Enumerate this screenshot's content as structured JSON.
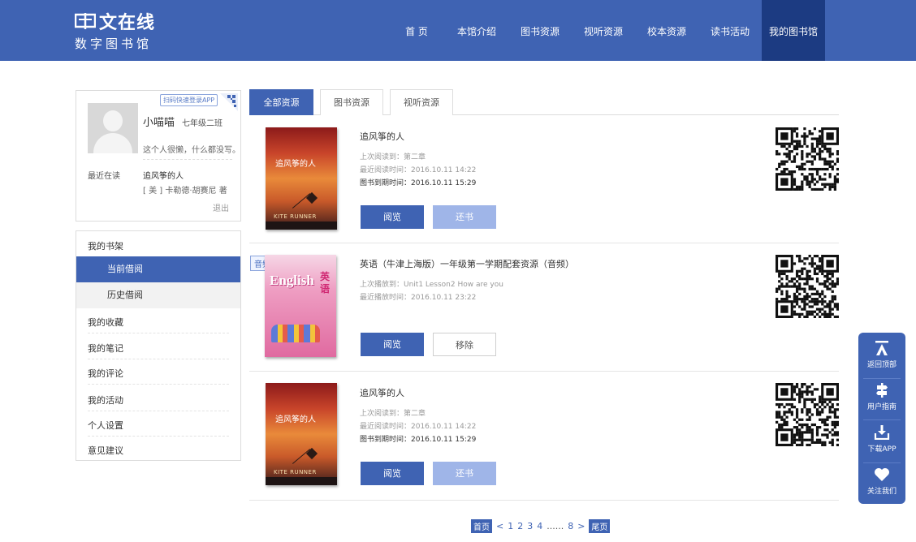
{
  "header": {
    "logo_title": "文在线",
    "logo_sub": "数字图书馆",
    "nav": [
      {
        "label": "首 页"
      },
      {
        "label": "本馆介绍"
      },
      {
        "label": "图书资源"
      },
      {
        "label": "视听资源"
      },
      {
        "label": "校本资源"
      },
      {
        "label": "读书活动"
      },
      {
        "label": "我的图书馆",
        "active": true
      }
    ]
  },
  "profile": {
    "scan_tag": "扫码快速登录APP",
    "username": "小喵喵",
    "grade": "七年级二班",
    "motto": "这个人很懒，什么都没写。",
    "recent_label": "最近在读",
    "recent_book": "追风筝的人",
    "recent_author": "[ 美 ] 卡勒德·胡赛尼  著",
    "logout": "退出"
  },
  "menu": {
    "shelf": "我的书架",
    "current": "当前借阅",
    "history": "历史借阅",
    "favorites": "我的收藏",
    "notes": "我的笔记",
    "comments": "我的评论",
    "activities": "我的活动",
    "settings": "个人设置",
    "feedback": "意见建议"
  },
  "tabs": [
    "全部资源",
    "图书资源",
    "视听资源"
  ],
  "items": [
    {
      "cover_title": "追风筝的人",
      "cover_sub": "KITE RUNNER",
      "title": "追风筝的人",
      "meta1": "上次阅读到：第二章",
      "meta2": "最近阅读时间：2016.10.11 14:22",
      "meta3": "图书到期时间：2016.10.11 15:29",
      "btn1": "阅览",
      "btn2": "还书"
    },
    {
      "badge": "音频",
      "cover_title": "English",
      "cover_cn": "英语",
      "title": "英语（牛津上海版）一年级第一学期配套资源（音频）",
      "meta1": "上次播放到：Unit1 Lesson2 How are you",
      "meta2": "最近播放时间：2016.10.11 23:22",
      "btn1": "阅览",
      "btn2": "移除"
    },
    {
      "cover_title": "追风筝的人",
      "cover_sub": "KITE RUNNER",
      "title": "追风筝的人",
      "meta1": "上次阅读到：第二章",
      "meta2": "最近阅读时间：2016.10.11 14:22",
      "meta3": "图书到期时间：2016.10.11 15:29",
      "btn1": "阅览",
      "btn2": "还书"
    }
  ],
  "pager": {
    "first": "首页",
    "prev": "<",
    "pages": [
      "1",
      "2",
      "3",
      "4"
    ],
    "dots": "......",
    "last_num": "8",
    "next": ">",
    "last": "尾页"
  },
  "float": {
    "top": "返回顶部",
    "guide": "用户指南",
    "download": "下载APP",
    "follow": "关注我们"
  },
  "colors": {
    "brand": "#3f63b3",
    "nav_active": "#1c3b82",
    "btn_disabled": "#9fb5e8"
  }
}
